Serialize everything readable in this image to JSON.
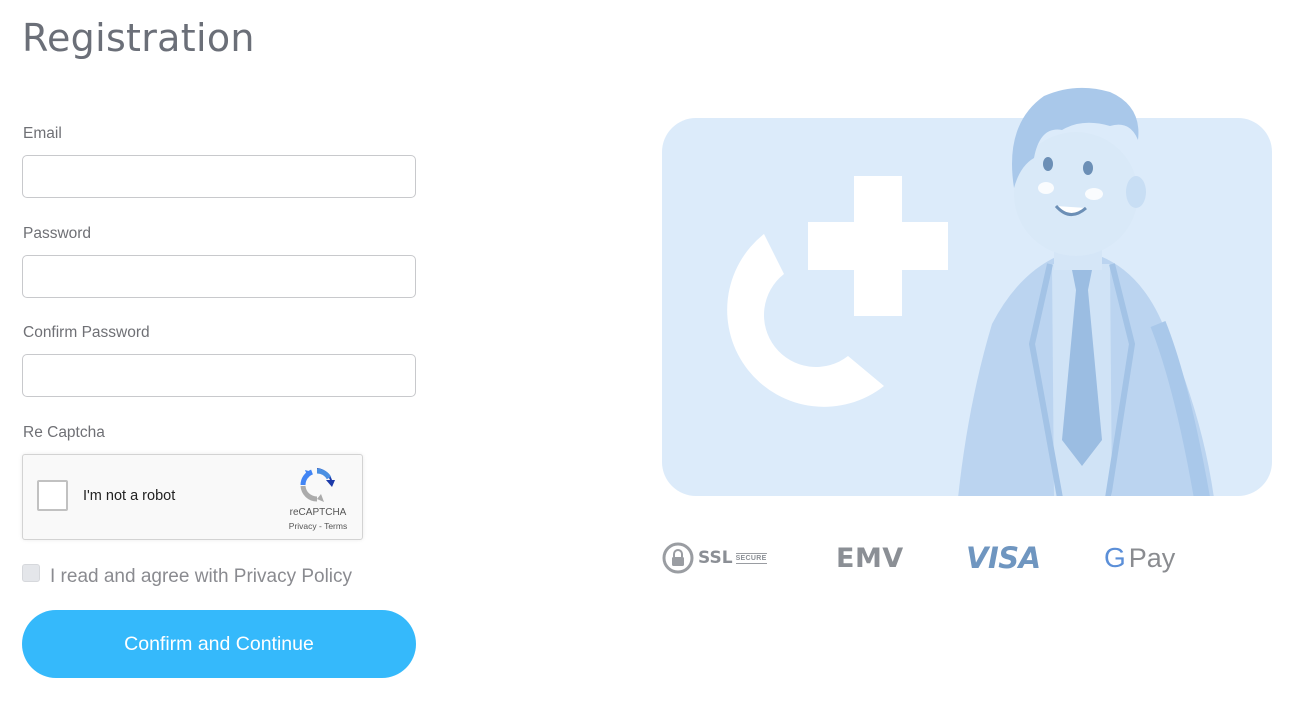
{
  "page": {
    "title": "Registration"
  },
  "form": {
    "email": {
      "label": "Email",
      "value": "",
      "placeholder": ""
    },
    "password": {
      "label": "Password",
      "value": "",
      "placeholder": ""
    },
    "confirm_password": {
      "label": "Confirm Password",
      "value": "",
      "placeholder": ""
    },
    "recaptcha": {
      "label": "Re Captcha",
      "checkbox_text": "I'm not a robot",
      "brand": "reCAPTCHA",
      "links": "Privacy - Terms",
      "checked": false
    },
    "agree": {
      "text": "I read and agree with Privacy Policy",
      "checked": false
    },
    "submit_label": "Confirm and Continue"
  },
  "payment_badges": {
    "ssl": {
      "text": "SSL",
      "sub": "SECURE"
    },
    "emv": "EMV",
    "visa": "VISA",
    "gpay": {
      "g": "G",
      "text": "Pay"
    }
  },
  "colors": {
    "accent": "#35b9fb",
    "illustration_bg": "#dcebfa",
    "title": "#6b6f78"
  }
}
